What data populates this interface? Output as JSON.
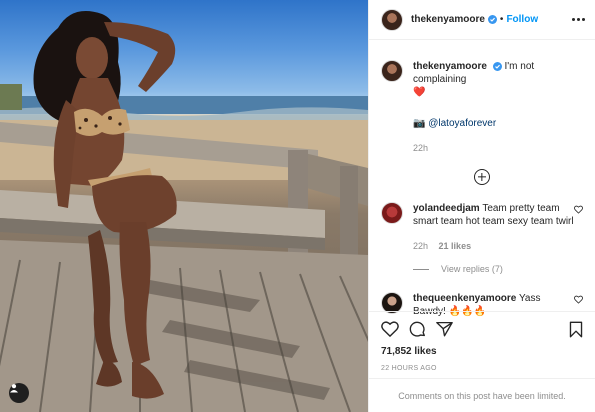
{
  "header": {
    "username": "thekenyamoore",
    "separator": "•",
    "follow_label": "Follow"
  },
  "caption": {
    "username": "thekenyamoore",
    "text": "I'm not complaining",
    "emoji": "❤️",
    "camera_emoji": "📷",
    "mention": "@latoyaforever",
    "time": "22h"
  },
  "comments": [
    {
      "username": "yolandeedjam",
      "text": "Team pretty team smart team hot team sexy team twirl",
      "time": "22h",
      "likes": "21 likes",
      "view_replies": "View replies (7)"
    },
    {
      "username": "thequeenkenyamoore",
      "text": "Yass Bawdy!",
      "emoji": "🔥🔥🔥"
    }
  ],
  "post": {
    "likes": "71,852 likes",
    "posted": "22 HOURS AGO",
    "comments_notice": "Comments on this post have been limited."
  },
  "icons": {
    "verified": "verified-badge-icon",
    "more": "more-options-icon",
    "add": "load-more-comments-icon",
    "like": "heart-icon",
    "comment": "comment-icon",
    "share": "share-icon",
    "save": "bookmark-icon",
    "tag": "user-tag-icon"
  },
  "colors": {
    "accent": "#0095f6",
    "verified": "#3897f0",
    "text": "#262626",
    "muted": "#8e8e8e"
  }
}
